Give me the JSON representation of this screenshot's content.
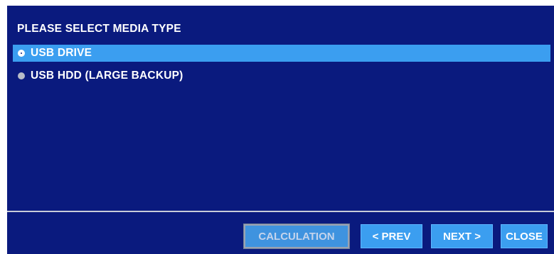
{
  "dialog": {
    "title": "PLEASE SELECT MEDIA TYPE",
    "options": [
      {
        "label": "USB DRIVE",
        "selected": true
      },
      {
        "label": "USB HDD (LARGE BACKUP)",
        "selected": false
      }
    ]
  },
  "buttons": {
    "calculation": "CALCULATION",
    "prev": "< PREV",
    "next": "NEXT >",
    "close": "CLOSE"
  },
  "colors": {
    "panel_background": "#0a1a7e",
    "highlight": "#3b9ef0",
    "text": "#ffffff"
  }
}
